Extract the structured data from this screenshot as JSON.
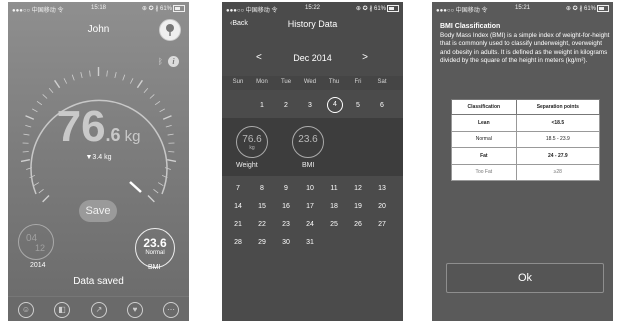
{
  "status": {
    "p1": {
      "carrier": "●●●○○ 中国移动 令",
      "time": "15:18",
      "right": "⊕ ✪ ∦ 61%"
    },
    "p2": {
      "carrier": "●●●○○ 中国移动 令",
      "time": "15:22",
      "right": "⊕ ✪ ∦ 61%"
    },
    "p3": {
      "carrier": "●●●○○ 中国移动 令",
      "time": "15:21",
      "right": "⊕ ✪ ∦ 61%"
    }
  },
  "home": {
    "user": "John",
    "weight_int": "76",
    "weight_dec": ".6",
    "unit": "kg",
    "delta": "▼3.4 kg",
    "save": "Save",
    "date_month": "04",
    "date_day": "12",
    "year": "2014",
    "bmi_value": "23.6",
    "bmi_status": "Normal",
    "bmi_label": "BMI",
    "saved_msg": "Data saved",
    "info_icon": "i",
    "bluetooth_icon": "bluetooth-icon"
  },
  "history": {
    "back": "Back",
    "title": "History Data",
    "month": "Dec 2014",
    "prev": "<",
    "next": ">",
    "weekdays": [
      "Sun",
      "Mon",
      "Tue",
      "Wed",
      "Thu",
      "Fri",
      "Sat"
    ],
    "week1": [
      "1",
      "2",
      "3",
      "4",
      "5",
      "6"
    ],
    "selected_day": "4",
    "summary": {
      "weight_value": "76.6",
      "weight_unit": "kg",
      "weight_label": "Weight",
      "bmi_value": "23.6",
      "bmi_label": "BMI"
    },
    "rows": [
      [
        "7",
        "8",
        "9",
        "10",
        "11",
        "12",
        "13"
      ],
      [
        "14",
        "15",
        "16",
        "17",
        "18",
        "19",
        "20"
      ],
      [
        "21",
        "22",
        "23",
        "24",
        "25",
        "26",
        "27"
      ],
      [
        "28",
        "29",
        "30",
        "31"
      ]
    ]
  },
  "bmi_info": {
    "title": "BMI Classification",
    "body": "Body Mass Index (BMI) is a simple index of weight-for-height that is commonly used to classify underweight, overweight and obesity in adults. It is defined as the weight in kilograms divided by the square of the height in meters (kg/m²).",
    "headers": [
      "Classification",
      "Separation points"
    ],
    "rows": [
      [
        "Lean",
        "<18.5"
      ],
      [
        "Normal",
        "18.5 - 23.9"
      ],
      [
        "Fat",
        "24 - 27.9"
      ],
      [
        "Too Fat",
        "≥28"
      ]
    ],
    "ok": "Ok"
  },
  "colors": {
    "bg": "#7d7d7d",
    "history_bg": "#4b4b4b",
    "info_bg": "#5a5a5a",
    "text": "#ffffff"
  },
  "tab_icons": [
    "user-icon",
    "scale-icon",
    "trend-icon",
    "heart-icon",
    "more-icon"
  ]
}
